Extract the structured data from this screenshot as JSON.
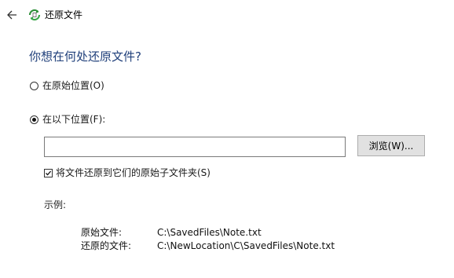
{
  "window": {
    "title": "还原文件"
  },
  "icons": {
    "back": "arrow-left-icon",
    "app": "recycle-restore-icon",
    "checkmark": "check-icon"
  },
  "colors": {
    "heading": "#1f3f7a",
    "button_bg": "#e1e1e1",
    "input_border": "#7a7a7a"
  },
  "main": {
    "heading": "你想在何处还原文件?",
    "option_original": {
      "label": "在原始位置(O)",
      "checked": false
    },
    "option_custom": {
      "label": "在以下位置(F):",
      "checked": true
    },
    "path_input": {
      "value": ""
    },
    "browse_button": "浏览(W)...",
    "subfolder_checkbox": {
      "label": "将文件还原到它们的原始子文件夹(S)",
      "checked": true
    },
    "example": {
      "label": "示例:",
      "rows": [
        {
          "key": "原始文件:",
          "value": "C:\\SavedFiles\\Note.txt"
        },
        {
          "key": "还原的文件:",
          "value": "C:\\NewLocation\\C\\SavedFiles\\Note.txt"
        }
      ]
    }
  }
}
